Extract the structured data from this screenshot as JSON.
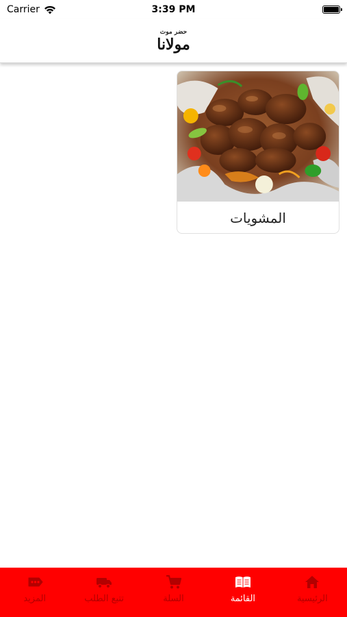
{
  "status_bar": {
    "carrier": "Carrier",
    "time": "3:39 PM"
  },
  "header": {
    "logo_top": "حضر موت",
    "logo_main": "مولانا"
  },
  "categories": [
    {
      "title": "المشويات",
      "image_icon": "grilled-meat-photo"
    }
  ],
  "tabs": [
    {
      "label": "المزيد",
      "icon": "more-icon",
      "active": false
    },
    {
      "label": "تتبع الطلب",
      "icon": "truck-icon",
      "active": false
    },
    {
      "label": "السلة",
      "icon": "cart-icon",
      "active": false
    },
    {
      "label": "القائمة",
      "icon": "menu-book-icon",
      "active": true
    },
    {
      "label": "الرئيسية",
      "icon": "home-icon",
      "active": false
    }
  ],
  "colors": {
    "tab_bar": "#ff0000",
    "tab_active": "#ffffff",
    "tab_inactive": "#b30000"
  }
}
